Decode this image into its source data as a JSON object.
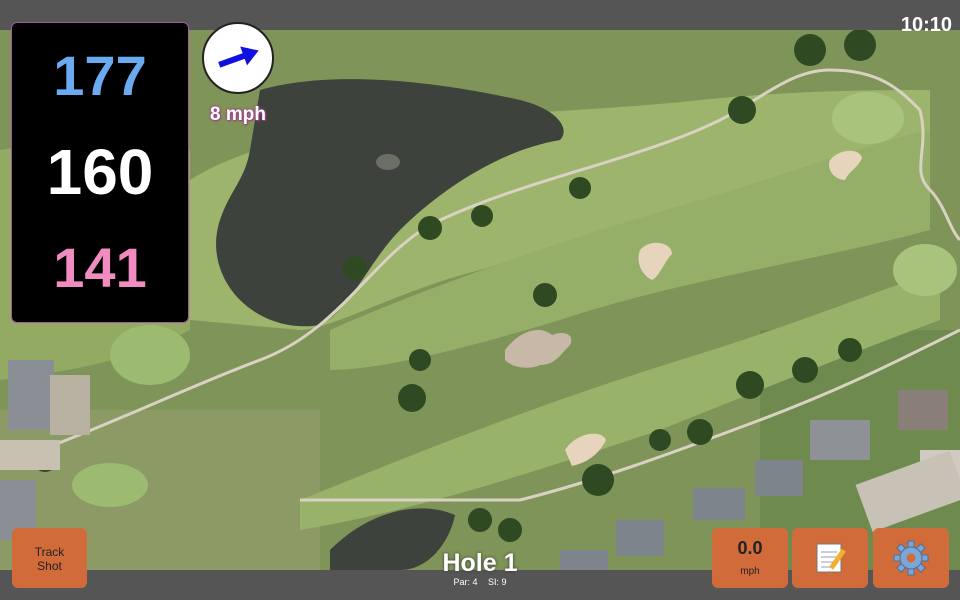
{
  "status": {
    "time": "10:10"
  },
  "yardages": {
    "back": "177",
    "center": "160",
    "front": "141"
  },
  "wind": {
    "speed_label": "8 mph",
    "icon": "wind-arrow-icon"
  },
  "hole": {
    "title": "Hole 1",
    "par": "Par: 4",
    "stroke_index": "SI: 9"
  },
  "buttons": {
    "track_line1": "Track",
    "track_line2": "Shot",
    "speed_value": "0.0",
    "speed_unit": "mph",
    "notes_icon": "notepad-icon",
    "settings_icon": "gear-icon"
  },
  "colors": {
    "back": "#6aaaf0",
    "center": "#ffffff",
    "front": "#f08cc0",
    "button": "#d26b3a"
  }
}
